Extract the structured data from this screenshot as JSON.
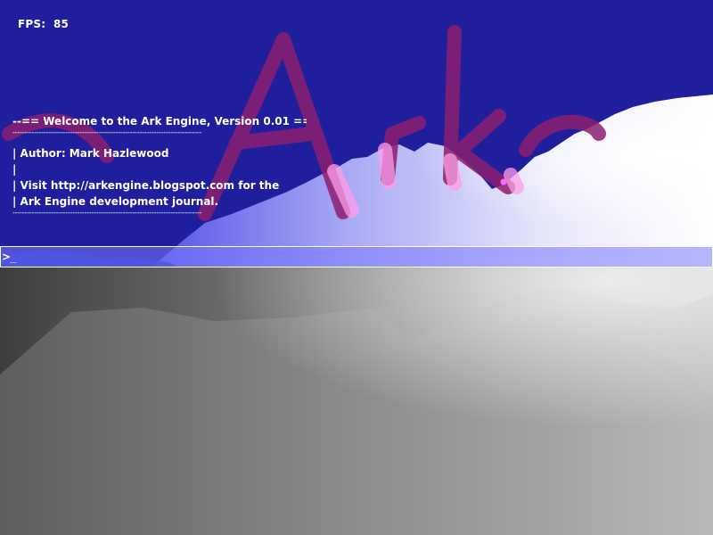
{
  "hud": {
    "fps_label": "FPS:  85"
  },
  "console": {
    "lines": [
      "--== Welcome to the Ark Engine, Version 0.01 ==--",
      "-------------------------------------------------------------------------------",
      "| Author: Mark Hazlewood",
      "|",
      "| Visit http://arkengine.blogspot.com for the",
      "| Ark Engine development journal.",
      "-------------------------------------------------------------------------------"
    ]
  },
  "command_line": {
    "prompt": ">",
    "value": "_"
  },
  "scene": {
    "watermark_text": "Ark",
    "colors": {
      "sky": "#1f1f9e",
      "watermark": "#8b1f6e",
      "ground_dark": "#3e3e3e",
      "ground_light": "#d9d9d9",
      "command_bar": "#7878ff"
    }
  }
}
